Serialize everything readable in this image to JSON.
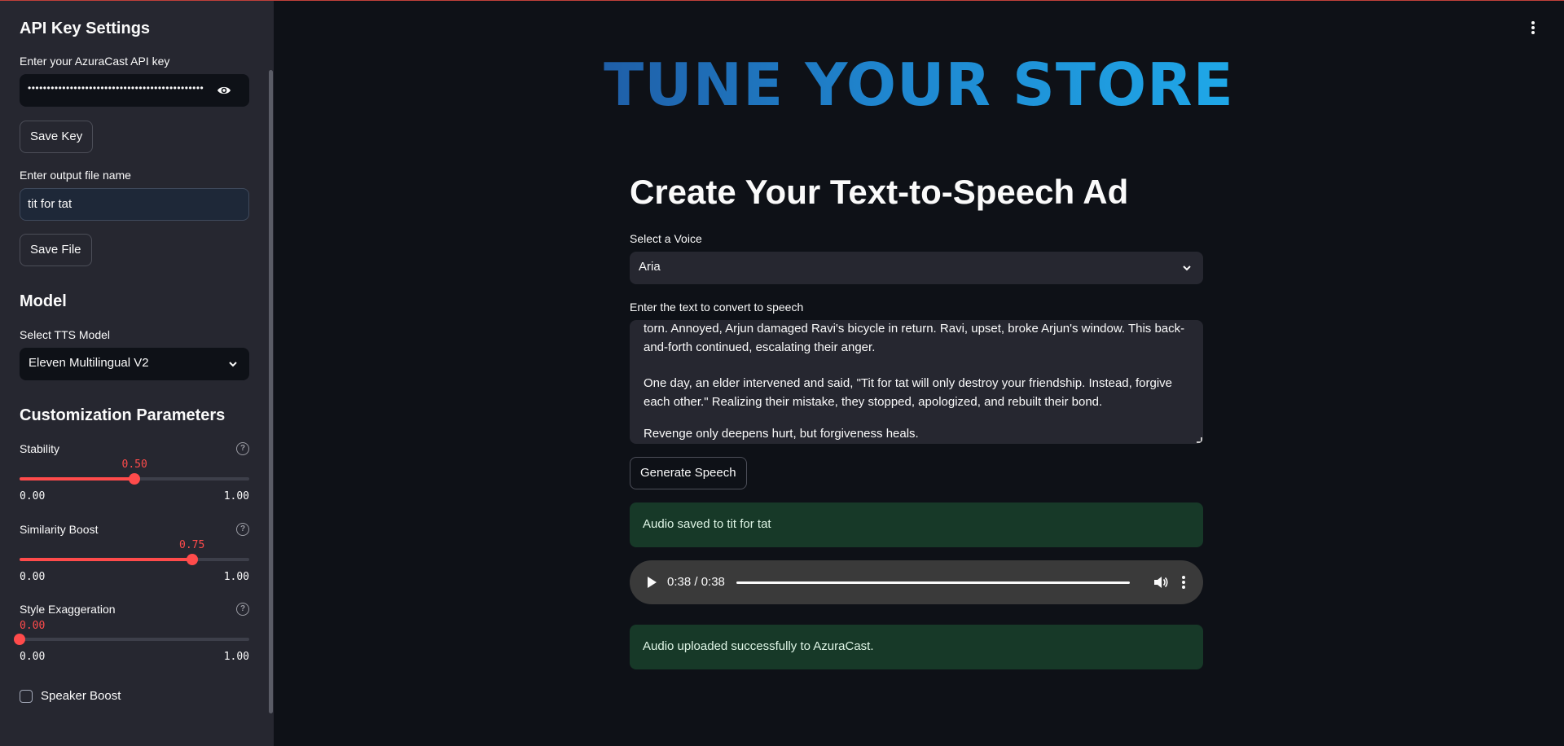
{
  "sidebar": {
    "api_heading": "API Key Settings",
    "api_label": "Enter your AzuraCast API key",
    "api_value": "••••••••••••••••••••••••••••••••••••••••••••••",
    "save_key_label": "Save Key",
    "file_label": "Enter output file name",
    "file_value": "tit for tat",
    "save_file_label": "Save File",
    "model_heading": "Model",
    "model_label": "Select TTS Model",
    "model_value": "Eleven Multilingual V2",
    "params_heading": "Customization Parameters",
    "sliders": [
      {
        "label": "Stability",
        "value": "0.50",
        "fraction": 0.5,
        "min": "0.00",
        "max": "1.00"
      },
      {
        "label": "Similarity Boost",
        "value": "0.75",
        "fraction": 0.75,
        "min": "0.00",
        "max": "1.00"
      },
      {
        "label": "Style Exaggeration",
        "value": "0.00",
        "fraction": 0.0,
        "min": "0.00",
        "max": "1.00"
      }
    ],
    "speaker_boost_label": "Speaker Boost",
    "help_glyph": "?"
  },
  "main": {
    "brand_title": "TUNE YOUR STORE",
    "page_title": "Create Your Text-to-Speech Ad",
    "voice_label": "Select a Voice",
    "voice_value": "Aria",
    "text_label": "Enter the text to convert to speech",
    "text_lines": [
      "torn. Annoyed, Arjun damaged Ravi's bicycle in return. Ravi, upset, broke Arjun's window. This back-and-forth continued, escalating their anger.",
      "One day, an elder intervened and said, \"Tit for tat will only destroy your friendship. Instead, forgive each other.\" Realizing their mistake, they stopped, apologized, and rebuilt their bond.",
      "Revenge only deepens hurt, but forgiveness heals."
    ],
    "generate_label": "Generate Speech",
    "alert_saved": "Audio saved to tit for tat",
    "audio_time": "0:38 / 0:38",
    "alert_uploaded": "Audio uploaded successfully to AzuraCast."
  },
  "colors": {
    "accent": "#ff4b4b",
    "sidebar_bg": "#262730",
    "main_bg": "#0e1117",
    "success_bg": "#173928"
  }
}
